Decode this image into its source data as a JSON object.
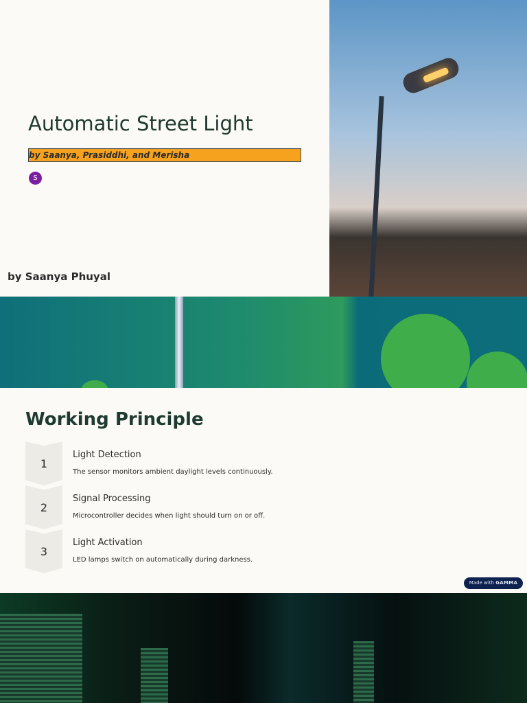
{
  "hero": {
    "title": "Automatic Street Light",
    "authors": "by Saanya, Prasiddhi, and Merisha",
    "avatar_initial": "S",
    "byline": "by Saanya Phuyal"
  },
  "principle": {
    "title": "Working Principle",
    "steps": [
      {
        "number": "1",
        "title": "Light Detection",
        "desc": "The sensor monitors ambient daylight levels continuously."
      },
      {
        "number": "2",
        "title": "Signal Processing",
        "desc": "Microcontroller decides when light should turn on or off."
      },
      {
        "number": "3",
        "title": "Light Activation",
        "desc": "LED lamps switch on automatically during darkness."
      }
    ]
  },
  "badge": {
    "prefix": "Made with",
    "brand": "GAMMA"
  },
  "colors": {
    "accent": "#f7a21e",
    "title": "#1f3a30",
    "avatar": "#7b1fa2",
    "badge": "#0e2250"
  }
}
